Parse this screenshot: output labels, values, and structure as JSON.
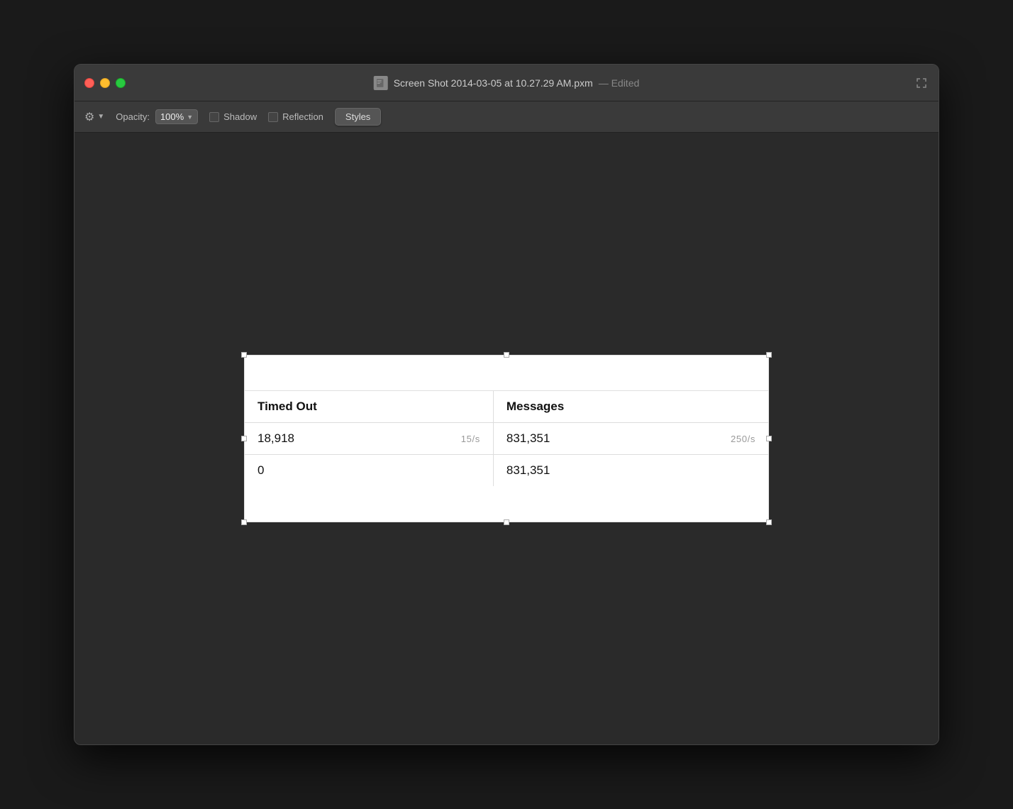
{
  "window": {
    "title": "Screen Shot 2014-03-05 at 10.27.29 AM.pxm",
    "edited_label": "— Edited"
  },
  "toolbar": {
    "gear_label": "⚙",
    "opacity_label": "Opacity:",
    "opacity_value": "100%",
    "shadow_label": "Shadow",
    "reflection_label": "Reflection",
    "styles_label": "Styles"
  },
  "table": {
    "columns": [
      {
        "header": "Timed Out"
      },
      {
        "header": "Messages"
      }
    ],
    "rows": [
      {
        "cells": [
          {
            "value": "18,918",
            "rate": "15/s"
          },
          {
            "value": "831,351",
            "rate": "250/s"
          }
        ]
      },
      {
        "cells": [
          {
            "value": "0",
            "rate": ""
          },
          {
            "value": "831,351",
            "rate": ""
          }
        ]
      }
    ]
  }
}
